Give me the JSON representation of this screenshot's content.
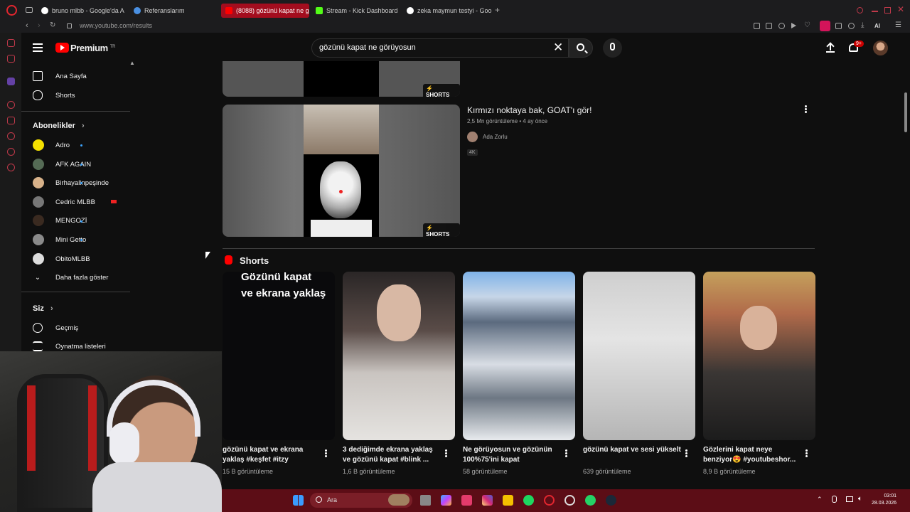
{
  "browser": {
    "tabs": [
      {
        "label": "bruno mlbb - Google'da A",
        "favicon_color": "#ffffff"
      },
      {
        "label": "Referanslarım",
        "favicon_color": "#4a90e2"
      },
      {
        "label": "(8088) gözünü kapat ne g",
        "favicon_color": "#ff0000",
        "active": true
      },
      {
        "label": "Stream - Kick Dashboard",
        "favicon_color": "#53fc18"
      },
      {
        "label": "zeka maymun testyi - Goo",
        "favicon_color": "#ffffff"
      }
    ],
    "new_tab_label": "+",
    "url": "www.youtube.com/results",
    "ai_label": "AI"
  },
  "header": {
    "brand": "Premium",
    "region": "TR",
    "search_value": "gözünü kapat ne görüyosun",
    "notification_count": "9+"
  },
  "sidebar": {
    "main_items": [
      {
        "label": "Ana Sayfa",
        "icon": "home-icon"
      },
      {
        "label": "Shorts",
        "icon": "shorts-icon"
      }
    ],
    "subscriptions_title": "Abonelikler",
    "subscriptions": [
      {
        "label": "Adro",
        "color": "#f4e000"
      },
      {
        "label": "AFK AGAIN",
        "color": "#556b55"
      },
      {
        "label": "Birhayalinpeşinde",
        "color": "#d8b28a"
      },
      {
        "label": "Cedric MLBB",
        "color": "#777777"
      },
      {
        "label": "MENGOZİ",
        "color": "#3a2a20"
      },
      {
        "label": "Mini Getto",
        "color": "#8a8a8a"
      },
      {
        "label": "ObitoMLBB",
        "color": "#dddddd"
      }
    ],
    "show_more": "Daha fazla göster",
    "you_title": "Siz",
    "you_items": [
      {
        "label": "Geçmiş",
        "icon": "history-icon"
      },
      {
        "label": "Oynatma listeleri",
        "icon": "playlist-icon"
      }
    ]
  },
  "results": {
    "shorts_badge": "SHORTS",
    "video": {
      "title": "Kırmızı noktaya bak, GOAT'ı gör!",
      "views": "2,5 Mn görüntüleme",
      "age": "4 ay önce",
      "channel": "Ada Zorlu",
      "quality": "4K"
    },
    "shorts_section_title": "Shorts",
    "shorts": [
      {
        "title": "gözünü kapat ve ekrana yaklaş #keşfet #itzy",
        "views": "15 B görüntüleme",
        "overlay": "Gözünü kapat ve ekrana yaklaş"
      },
      {
        "title": "3 dediğimde ekrana yaklaş ve gözünü kapat #blink ...",
        "views": "1,6 B görüntüleme"
      },
      {
        "title": "Ne görüyosun ve gözünün 100%75'ini kapat",
        "views": "58 görüntüleme"
      },
      {
        "title": "gözünü kapat ve sesi yükselt",
        "views": "639 görüntüleme"
      },
      {
        "title": "Gözlerini kapat neye benziyor😍 #youtubeshor...",
        "views": "8,9 B görüntüleme"
      }
    ]
  },
  "taskbar": {
    "search_placeholder": "Ara",
    "time": "03:01",
    "date": "28.03.2026"
  },
  "colors": {
    "youtube_red": "#ff0000",
    "opera_red": "#a30d1e",
    "taskbar": "#5c0d16",
    "link_blue": "#3ea6ff"
  }
}
